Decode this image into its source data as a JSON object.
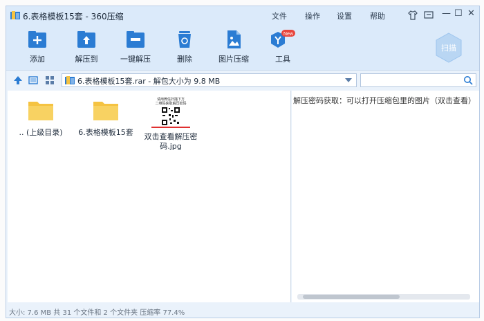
{
  "window": {
    "title": "6.表格模板15套 - 360压缩",
    "menu": [
      "文件",
      "操作",
      "设置",
      "帮助"
    ],
    "controls": {
      "minimize": "—",
      "maximize": "☐",
      "close": "✕"
    }
  },
  "toolbar": {
    "buttons": [
      {
        "label": "添加",
        "icon": "add-icon"
      },
      {
        "label": "解压到",
        "icon": "extract-to-icon"
      },
      {
        "label": "一键解压",
        "icon": "one-click-extract-icon"
      },
      {
        "label": "删除",
        "icon": "delete-icon"
      },
      {
        "label": "图片压缩",
        "icon": "image-compress-icon"
      },
      {
        "label": "工具",
        "icon": "tools-icon",
        "badge": "New"
      }
    ],
    "scan_label": "扫描"
  },
  "nav": {
    "address": "6.表格模板15套.rar - 解包大小为 9.8 MB",
    "search_placeholder": ""
  },
  "files": [
    {
      "name": ".. (上级目录)",
      "type": "folder"
    },
    {
      "name": "6.表格模板15套",
      "type": "folder"
    },
    {
      "name": "双击查看解压密码.jpg",
      "type": "image",
      "thumb_lines": [
        "请用微信扫描下方",
        "二维码获取解压密码"
      ]
    }
  ],
  "preview": {
    "text": "解压密码获取：可以打开压缩包里的图片（双击查看）"
  },
  "status": {
    "text": "大小: 7.6 MB 共 31 个文件和 2 个文件夹 压缩率 77.4%"
  },
  "colors": {
    "accent": "#2b7cd3",
    "folder": "#f5c342",
    "badge": "#e8453c"
  }
}
